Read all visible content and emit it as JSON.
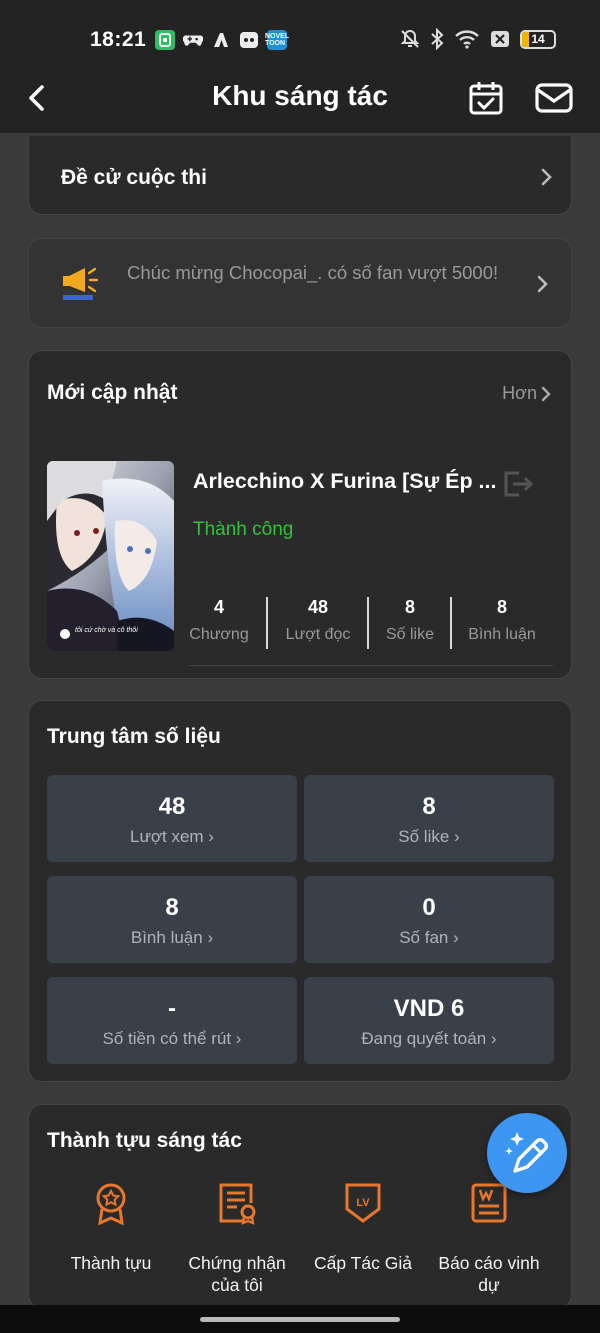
{
  "status_bar": {
    "time": "18:21",
    "battery": "14"
  },
  "header": {
    "title": "Khu sáng tác"
  },
  "contest": {
    "label": "Đề cử cuộc thi"
  },
  "notice": {
    "message": "Chúc mừng Chocopai_. có số fan vượt 5000!"
  },
  "recent": {
    "title": "Mới cập nhật",
    "more_label": "Hơn",
    "book": {
      "title": "Arlecchino X Furina [Sự Ép ...",
      "status": "Thành công",
      "cover_caption": "tôi cứ chờ và cô thôi",
      "stats": [
        {
          "value": "4",
          "label": "Chương"
        },
        {
          "value": "48",
          "label": "Lượt đọc"
        },
        {
          "value": "8",
          "label": "Số like"
        },
        {
          "value": "8",
          "label": "Bình luận"
        }
      ]
    }
  },
  "data_center": {
    "title": "Trung tâm số liệu",
    "tiles": [
      {
        "value": "48",
        "label": "Lượt xem"
      },
      {
        "value": "8",
        "label": "Số like"
      },
      {
        "value": "8",
        "label": "Bình luận"
      },
      {
        "value": "0",
        "label": "Số fan"
      },
      {
        "value": "-",
        "label": "Số tiền có thể rút"
      },
      {
        "value": "VND 6",
        "label": "Đang quyết toán"
      }
    ]
  },
  "achievements": {
    "title": "Thành tựu sáng tác",
    "items": [
      {
        "label": "Thành tựu",
        "icon": "medal-icon"
      },
      {
        "label": "Chứng nhận của tôi",
        "icon": "certificate-icon"
      },
      {
        "label": "Cấp Tác Giả",
        "icon": "level-badge-icon"
      },
      {
        "label": "Báo cáo vinh dự",
        "icon": "honor-report-icon"
      }
    ]
  },
  "colors": {
    "accent_orange": "#e8772e",
    "success_green": "#31c43a",
    "fab_blue": "#3d96f2"
  }
}
